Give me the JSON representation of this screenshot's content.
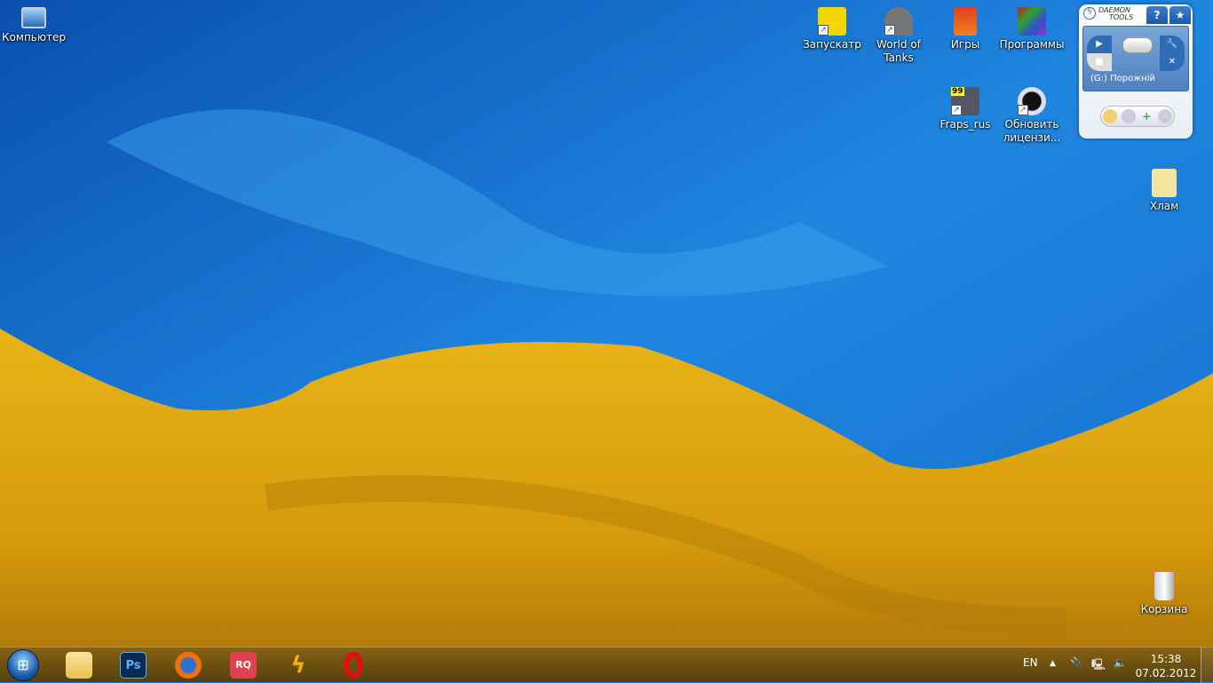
{
  "colors": {
    "blue": "#1a78d8",
    "yellow": "#e0a810"
  },
  "desktop_icons": [
    {
      "label": "Компьютер",
      "icon": "computer-icon"
    },
    {
      "label": "Запускатр",
      "icon": "launcher-icon"
    },
    {
      "label": "World of Tanks",
      "icon": "world-of-tanks-icon"
    },
    {
      "label": "Игры",
      "icon": "games-folder-icon"
    },
    {
      "label": "Программы",
      "icon": "programs-icon"
    },
    {
      "label": "Fraps_rus",
      "icon": "fraps-icon",
      "badge": "99"
    },
    {
      "label": "Обновить лицензи...",
      "icon": "update-license-icon"
    },
    {
      "label": "Хлам",
      "icon": "folder-icon"
    },
    {
      "label": "Корзина",
      "icon": "recycle-bin-icon"
    }
  ],
  "daemon": {
    "logo_line1": "DAEMON",
    "logo_line2": "TOOLS",
    "help": "?",
    "drive_status": "(G:) Порожній"
  },
  "taskbar": {
    "apps": [
      "Explorer",
      "Ps",
      "Firefox",
      "RQ",
      "Winamp",
      "Opera"
    ],
    "apps_text": {
      "ps": "Ps",
      "rq": "RQ"
    },
    "language": "EN",
    "time": "15:38",
    "date": "07.02.2012"
  }
}
